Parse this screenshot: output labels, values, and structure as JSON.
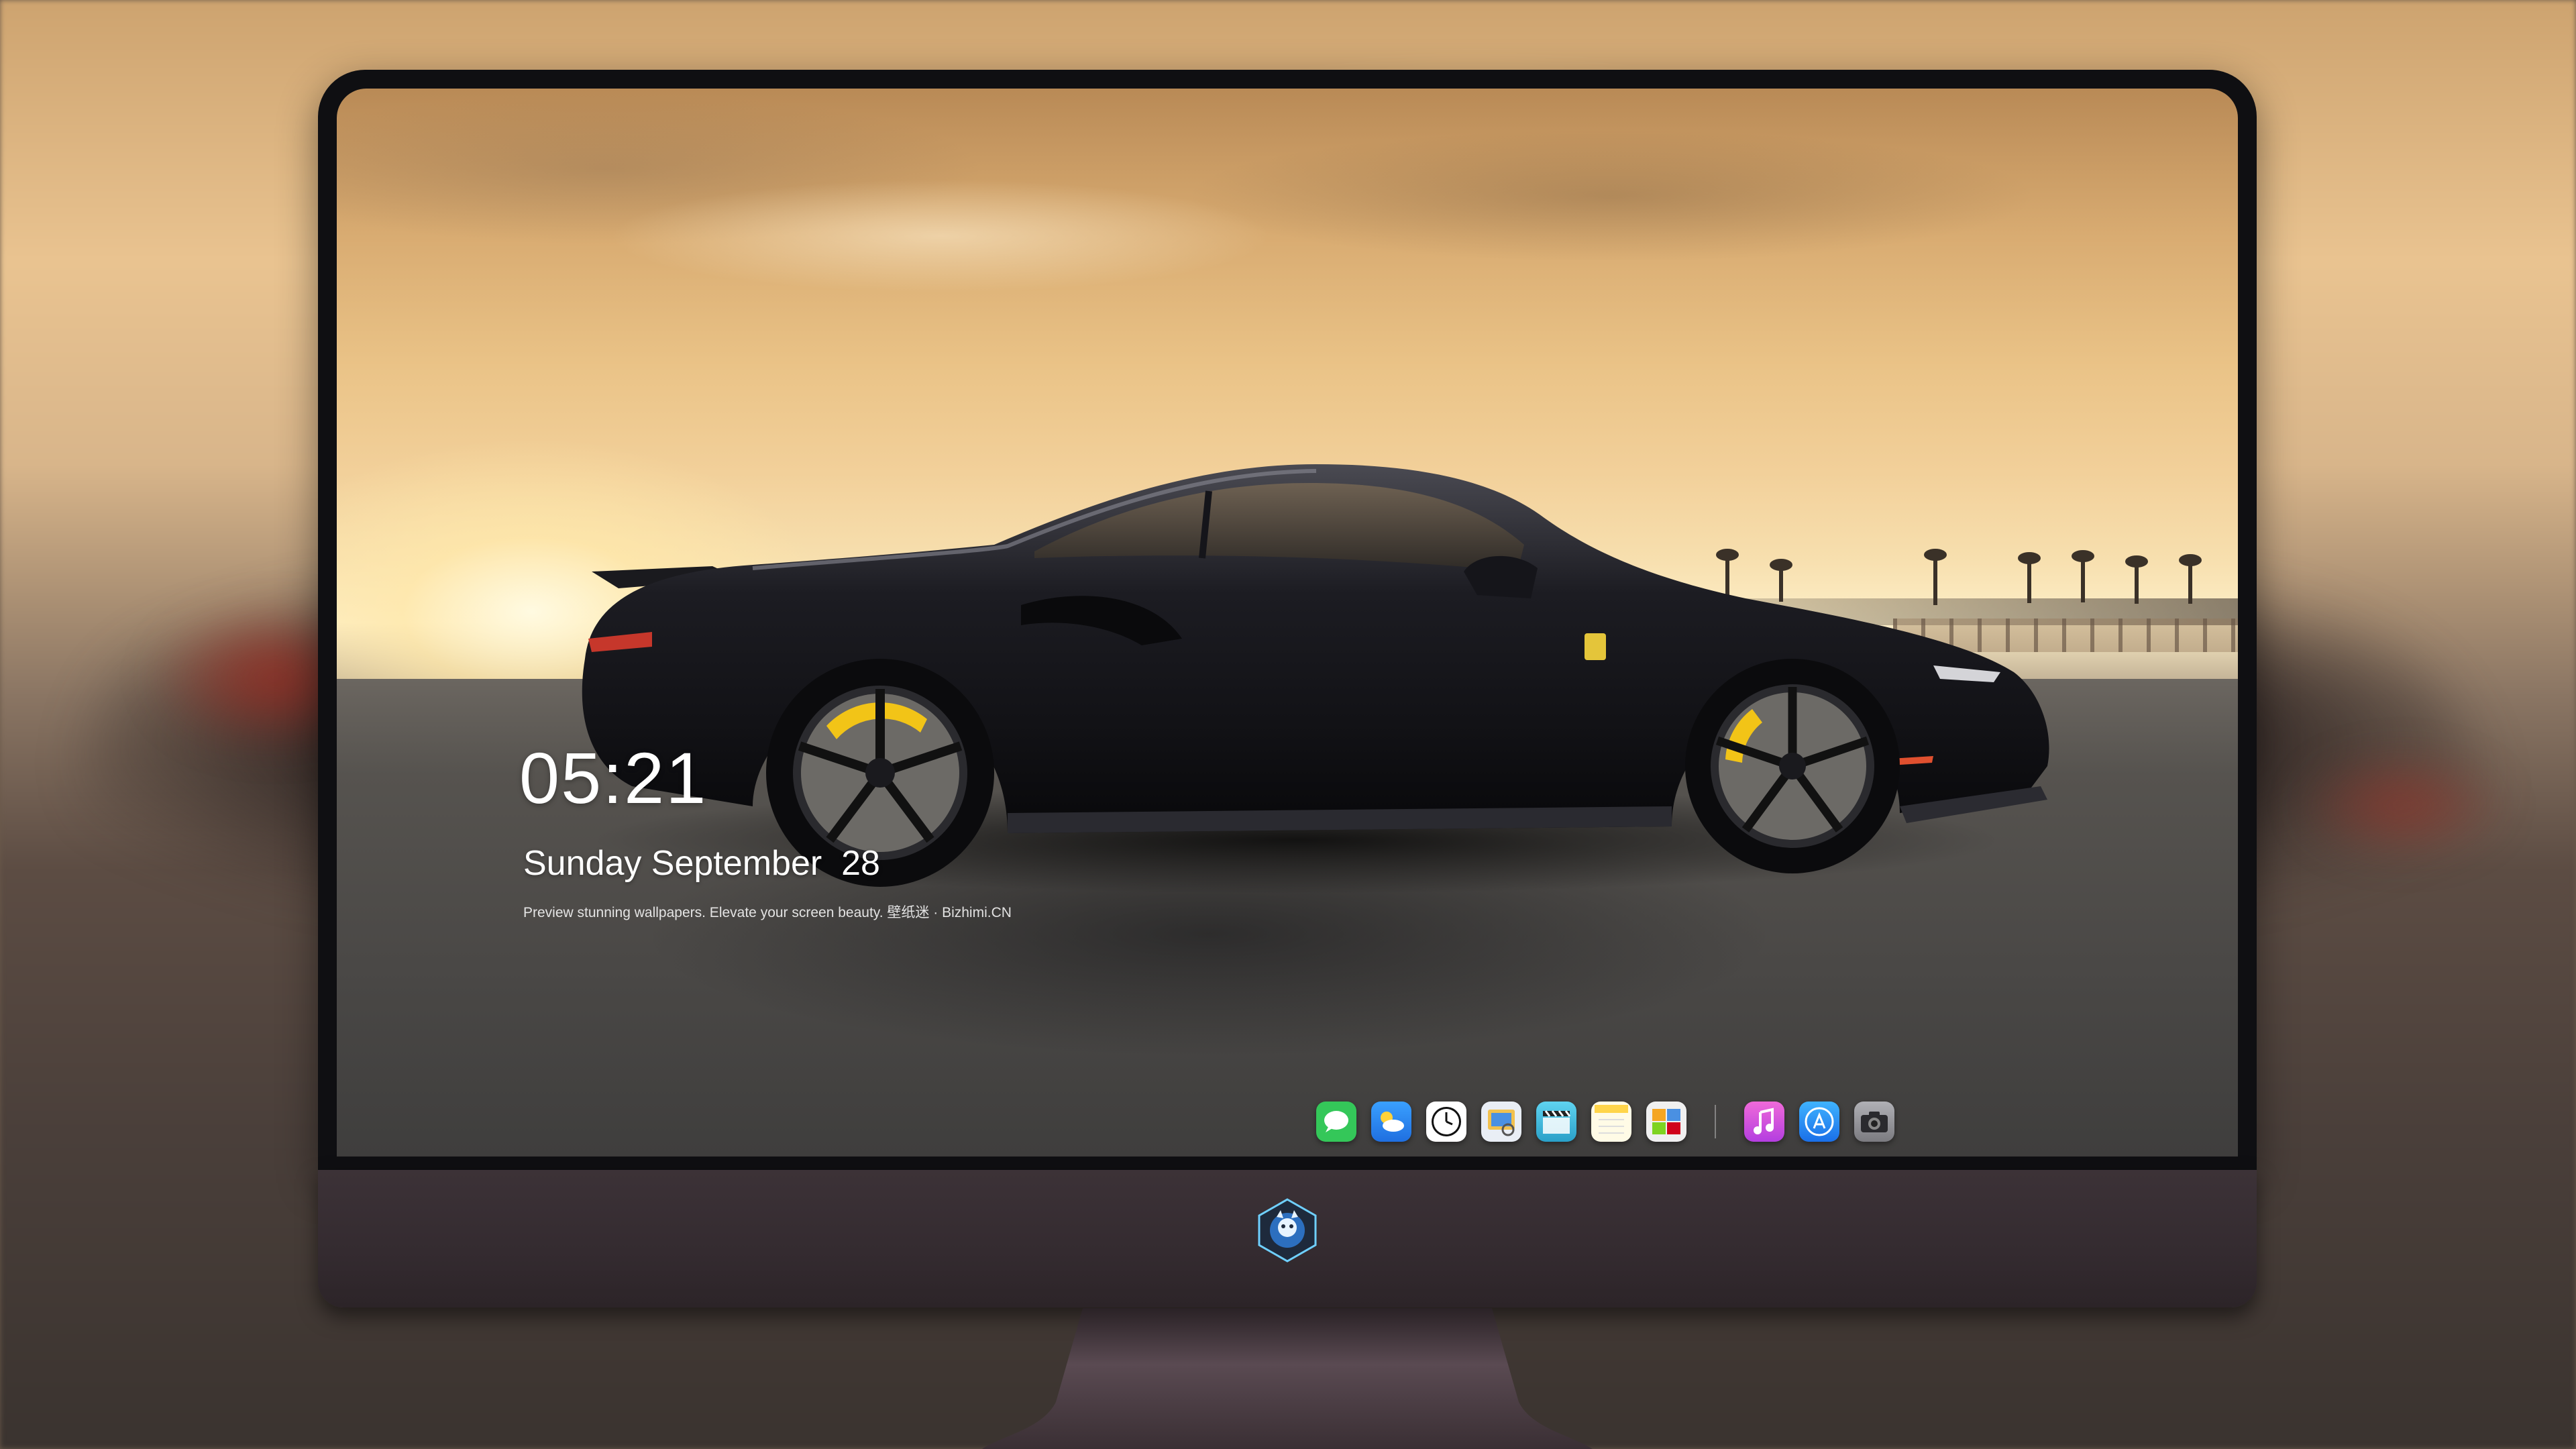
{
  "wallpaper": {
    "description_alt": "black sports car at sunset"
  },
  "lock_screen": {
    "time": "05:21",
    "date": "Sunday September  28",
    "tagline": "Preview stunning wallpapers. Elevate your screen beauty. 壁纸迷 · Bizhimi.CN"
  },
  "dock": {
    "items": [
      {
        "name": "messages-icon",
        "color": "#34c759"
      },
      {
        "name": "weather-icon",
        "color": "#2f8cf0"
      },
      {
        "name": "clock-icon",
        "color": "#ffffff"
      },
      {
        "name": "preview-icon",
        "color": "#f2c14e"
      },
      {
        "name": "video-clapper-icon",
        "color": "#38b6d8"
      },
      {
        "name": "notes-icon",
        "color": "#ffd54a"
      },
      {
        "name": "photo-gallery-icon",
        "color": "#f0f0f0"
      },
      {
        "name": "music-icon",
        "color": "#e84fd1"
      },
      {
        "name": "app-store-icon",
        "color": "#1f8ef1"
      },
      {
        "name": "camera-icon",
        "color": "#8e8e93"
      }
    ]
  },
  "colors": {
    "bezel": "#0f0f12",
    "chin": "#342b30",
    "caliper": "#f2c417"
  }
}
